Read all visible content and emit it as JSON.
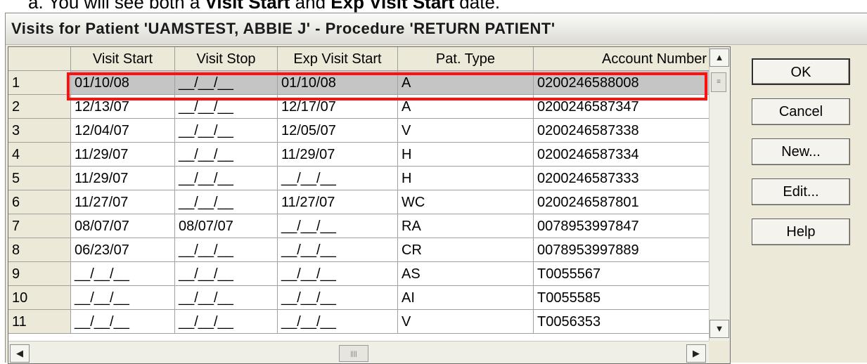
{
  "caption": {
    "prefix": "a.  You will see both a ",
    "bold1": "Visit Start",
    "middle": " and ",
    "bold2": "Exp Visit Start",
    "suffix": " date."
  },
  "window": {
    "title": "Visits for Patient 'UAMSTEST, ABBIE J' - Procedure 'RETURN PATIENT'"
  },
  "grid": {
    "columns": [
      "Visit Start",
      "Visit Stop",
      "Exp Visit Start",
      "Pat. Type",
      "Account Number"
    ],
    "rows": [
      {
        "num": "1",
        "visit_start": "01/10/08",
        "visit_stop": "__/__/__",
        "exp_visit_start": "01/10/08",
        "pat_type": "A",
        "account": "0200246588008"
      },
      {
        "num": "2",
        "visit_start": "12/13/07",
        "visit_stop": "__/__/__",
        "exp_visit_start": "12/17/07",
        "pat_type": "A",
        "account": "0200246587347"
      },
      {
        "num": "3",
        "visit_start": "12/04/07",
        "visit_stop": "__/__/__",
        "exp_visit_start": "12/05/07",
        "pat_type": "V",
        "account": "0200246587338"
      },
      {
        "num": "4",
        "visit_start": "11/29/07",
        "visit_stop": "__/__/__",
        "exp_visit_start": "11/29/07",
        "pat_type": "H",
        "account": "0200246587334"
      },
      {
        "num": "5",
        "visit_start": "11/29/07",
        "visit_stop": "__/__/__",
        "exp_visit_start": "__/__/__",
        "pat_type": "H",
        "account": "0200246587333"
      },
      {
        "num": "6",
        "visit_start": "11/27/07",
        "visit_stop": "__/__/__",
        "exp_visit_start": "11/27/07",
        "pat_type": "WC",
        "account": "0200246587801"
      },
      {
        "num": "7",
        "visit_start": "08/07/07",
        "visit_stop": "08/07/07",
        "exp_visit_start": "__/__/__",
        "pat_type": "RA",
        "account": "0078953997847"
      },
      {
        "num": "8",
        "visit_start": "06/23/07",
        "visit_stop": "__/__/__",
        "exp_visit_start": "__/__/__",
        "pat_type": "CR",
        "account": "0078953997889"
      },
      {
        "num": "9",
        "visit_start": "__/__/__",
        "visit_stop": "__/__/__",
        "exp_visit_start": "__/__/__",
        "pat_type": "AS",
        "account": "T0055567"
      },
      {
        "num": "10",
        "visit_start": "__/__/__",
        "visit_stop": "__/__/__",
        "exp_visit_start": "__/__/__",
        "pat_type": "AI",
        "account": "T0055585"
      },
      {
        "num": "11",
        "visit_start": "__/__/__",
        "visit_stop": "__/__/__",
        "exp_visit_start": "__/__/__",
        "pat_type": "V",
        "account": "T0056353"
      }
    ]
  },
  "buttons": {
    "ok": "OK",
    "cancel": "Cancel",
    "new": "New...",
    "edit": "Edit...",
    "help": "Help"
  },
  "icons": {
    "scroll_up": "chevron-up-icon",
    "scroll_down": "chevron-down-icon",
    "scroll_left": "chevron-left-icon",
    "scroll_right": "chevron-right-icon"
  },
  "colors": {
    "highlight": "#ff1010",
    "selected_row": "#c5c5c5"
  }
}
